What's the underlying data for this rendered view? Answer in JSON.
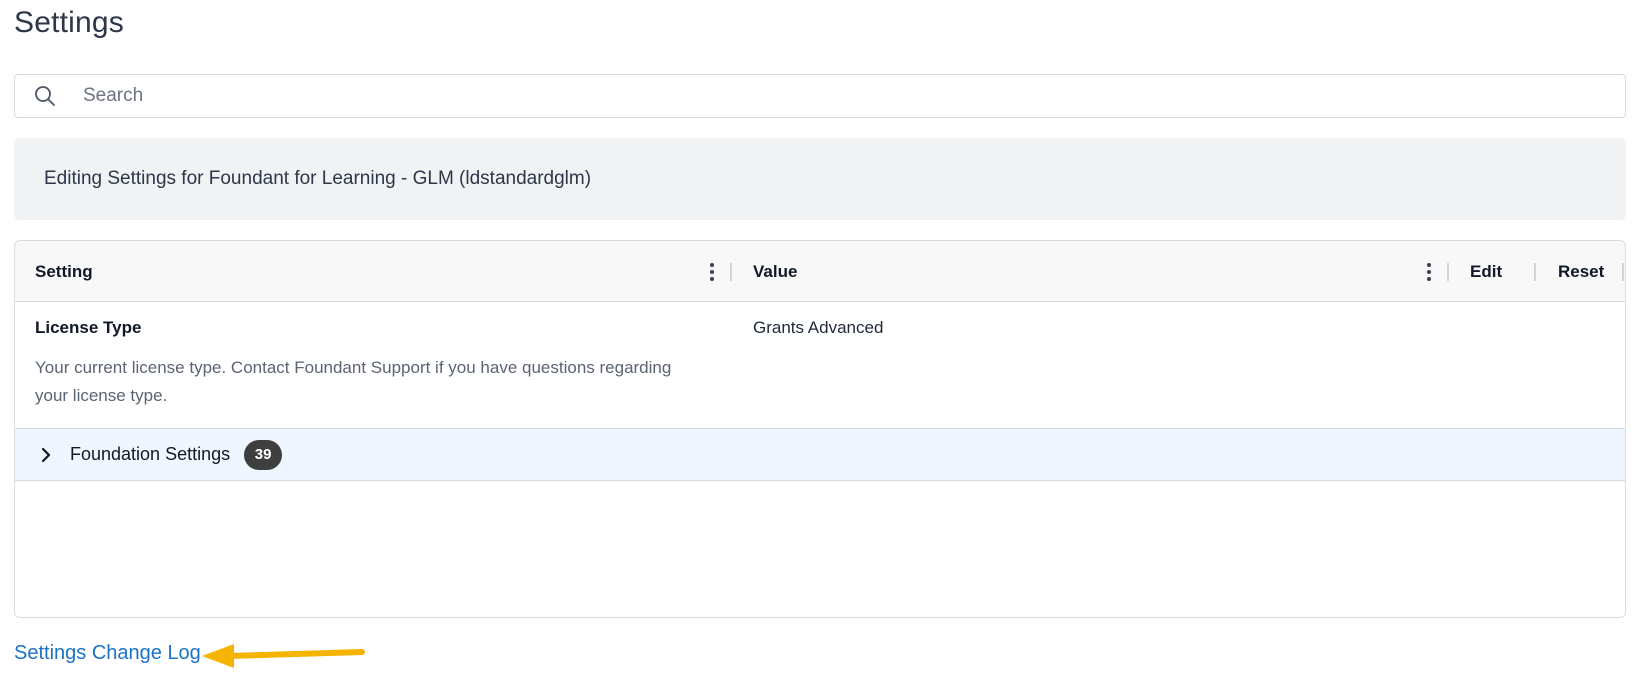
{
  "page": {
    "title": "Settings"
  },
  "search": {
    "placeholder": "Search"
  },
  "banner": {
    "text": "Editing Settings for Foundant for Learning - GLM (ldstandardglm)"
  },
  "table": {
    "columns": {
      "setting": "Setting",
      "value": "Value",
      "edit": "Edit",
      "reset": "Reset"
    },
    "rows": [
      {
        "name": "License Type",
        "description": "Your current license type. Contact Foundant Support if you have questions regarding your license type.",
        "value": "Grants Advanced"
      }
    ],
    "groups": [
      {
        "label": "Foundation Settings",
        "count": "39"
      }
    ]
  },
  "footer": {
    "change_log_label": "Settings Change Log"
  },
  "colors": {
    "link": "#1a73c8",
    "annotation_arrow": "#f5b400",
    "group_row_bg": "#eff6ff",
    "badge_bg": "#3f3f3f"
  },
  "icons": {
    "search": "search-icon",
    "chevron": "chevron-right-icon",
    "kebab": "more-vertical-icon",
    "arrow": "arrow-left-icon"
  }
}
